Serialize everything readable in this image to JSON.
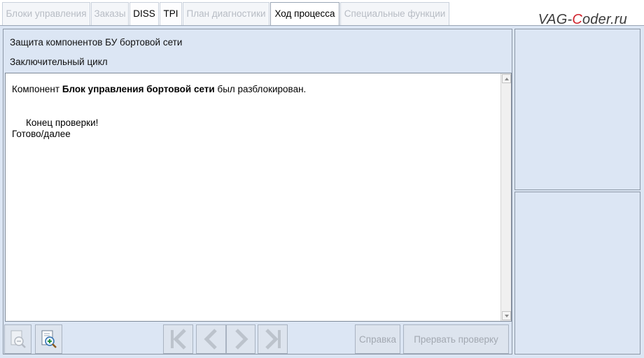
{
  "tabs": [
    {
      "label": "Блоки управления",
      "enabled": false
    },
    {
      "label": "Заказы",
      "enabled": false
    },
    {
      "label": "DISS",
      "enabled": true
    },
    {
      "label": "TPI",
      "enabled": true
    },
    {
      "label": "План диагностики",
      "enabled": false
    },
    {
      "label": "Ход процесса",
      "enabled": true,
      "active": true
    },
    {
      "label": "Специальные функции",
      "enabled": false
    }
  ],
  "watermark": {
    "part1": "VAG-",
    "part2": "C",
    "part3": "oder.ru"
  },
  "header": {
    "title": "Защита компонентов БУ бортовой сети",
    "subtitle": "Заключительный цикл"
  },
  "message": {
    "prefix": "Компонент ",
    "component": "Блок управления бортовой сети",
    "suffix": " был разблокирован.",
    "end_text": "Конец проверки!",
    "ready_text": "Готово/далее"
  },
  "toolbar": {
    "help_label": "Справка",
    "abort_label": "Прервать проверку"
  },
  "icons": {
    "zoom_out": "zoom-out-icon",
    "zoom_in": "zoom-in-icon",
    "first": "first-page-icon",
    "prev": "prev-page-icon",
    "next": "next-page-icon",
    "last": "last-page-icon"
  },
  "colors": {
    "background": "#dce6f4",
    "disabled_text": "#b7bcc4",
    "watermark_accent": "#d0202a"
  }
}
